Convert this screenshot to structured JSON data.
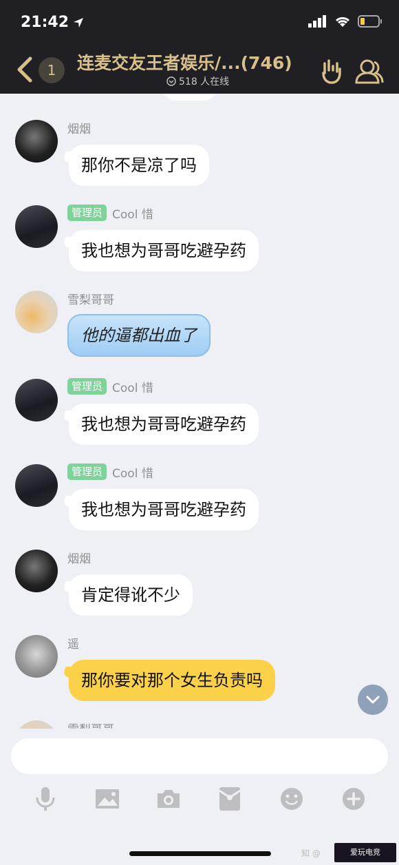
{
  "status_bar": {
    "time": "21:42"
  },
  "header": {
    "unread_count": "1",
    "title": "连麦交友王者娱乐/...(746)",
    "online_text": "518 人在线"
  },
  "messages": [
    {
      "sender": "烟烟",
      "role": "",
      "text": "那你不是凉了吗",
      "style": "white"
    },
    {
      "sender": "Cool 惜",
      "role": "管理员",
      "text": "我也想为哥哥吃避孕药",
      "style": "white"
    },
    {
      "sender": "雪梨哥哥",
      "role": "",
      "text": "他的逼都出血了",
      "style": "blue"
    },
    {
      "sender": "Cool 惜",
      "role": "管理员",
      "text": "我也想为哥哥吃避孕药",
      "style": "white"
    },
    {
      "sender": "Cool 惜",
      "role": "管理员",
      "text": "我也想为哥哥吃避孕药",
      "style": "white"
    },
    {
      "sender": "烟烟",
      "role": "",
      "text": "肯定得讹不少",
      "style": "white"
    },
    {
      "sender": "遥",
      "role": "",
      "text": "那你要对那个女生负责吗",
      "style": "yellow"
    },
    {
      "sender": "雪梨哥哥",
      "role": "",
      "text": "",
      "style": "partial"
    }
  ],
  "watermark": {
    "text": "爱玩电竞",
    "left_text": "知 @"
  },
  "colors": {
    "accent_gold": "#d9c08b",
    "admin_tag": "#7fd39a",
    "yellow_bubble": "#fcd14a"
  }
}
